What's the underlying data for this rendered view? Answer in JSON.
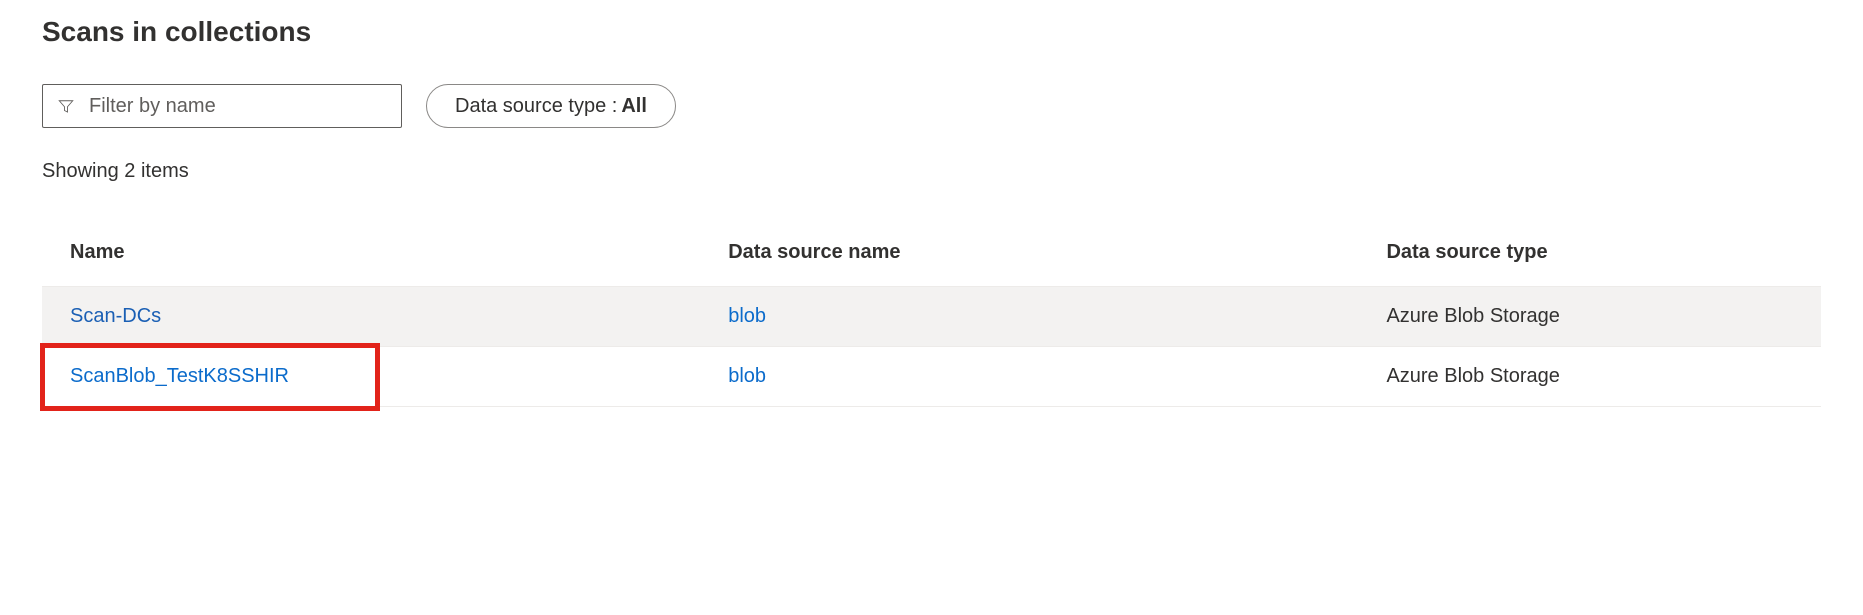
{
  "page": {
    "title": "Scans in collections"
  },
  "filters": {
    "name_placeholder": "Filter by name",
    "type_label": "Data source type :",
    "type_value": "All"
  },
  "results": {
    "count_text": "Showing 2 items"
  },
  "table": {
    "columns": {
      "name": "Name",
      "data_source_name": "Data source name",
      "data_source_type": "Data source type"
    },
    "rows": [
      {
        "name": "Scan-DCs",
        "data_source_name": "blob",
        "data_source_type": "Azure Blob Storage",
        "hovered": true,
        "highlighted": false
      },
      {
        "name": "ScanBlob_TestK8SSHIR",
        "data_source_name": "blob",
        "data_source_type": "Azure Blob Storage",
        "hovered": false,
        "highlighted": true
      }
    ]
  },
  "colors": {
    "link": "#0b6bcb",
    "highlight_border": "#e2231a",
    "row_hover_bg": "#f3f2f1"
  }
}
